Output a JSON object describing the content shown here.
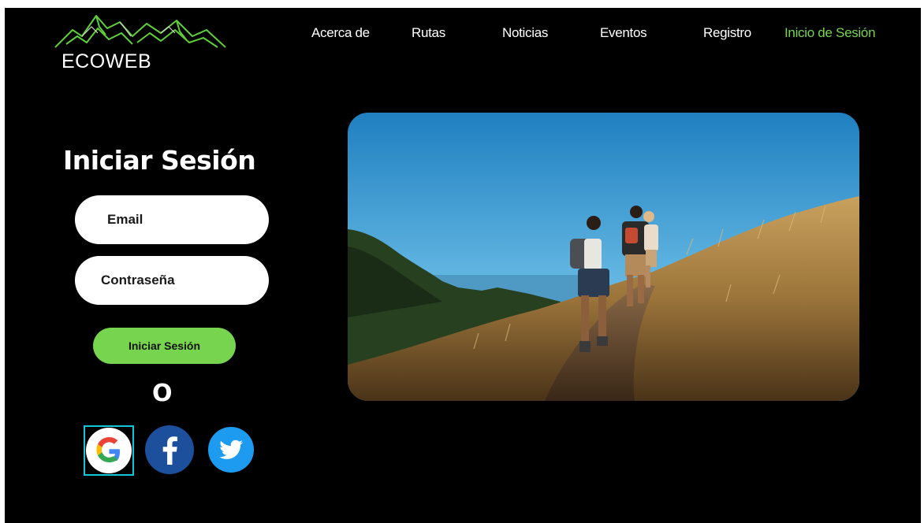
{
  "brand": {
    "name": "ECOWEB",
    "logo_icon": "mountain-range-icon",
    "accent_color": "#77d44f"
  },
  "nav": {
    "items": [
      {
        "label": "Acerca de"
      },
      {
        "label": "Rutas"
      },
      {
        "label": "Noticias"
      },
      {
        "label": "Eventos"
      },
      {
        "label": "Registro"
      },
      {
        "label": "Inicio de Sesión"
      }
    ],
    "active": "Inicio de Sesión"
  },
  "login": {
    "title": "Iniciar Sesión",
    "email_placeholder": "Email",
    "password_placeholder": "Contraseña",
    "submit_label": "Iniciar Sesión",
    "or_label": "O",
    "social": [
      {
        "icon": "google-icon"
      },
      {
        "icon": "facebook-icon"
      },
      {
        "icon": "twitter-icon"
      }
    ]
  },
  "hero": {
    "image": "hikers-on-grassy-hill-photo"
  }
}
